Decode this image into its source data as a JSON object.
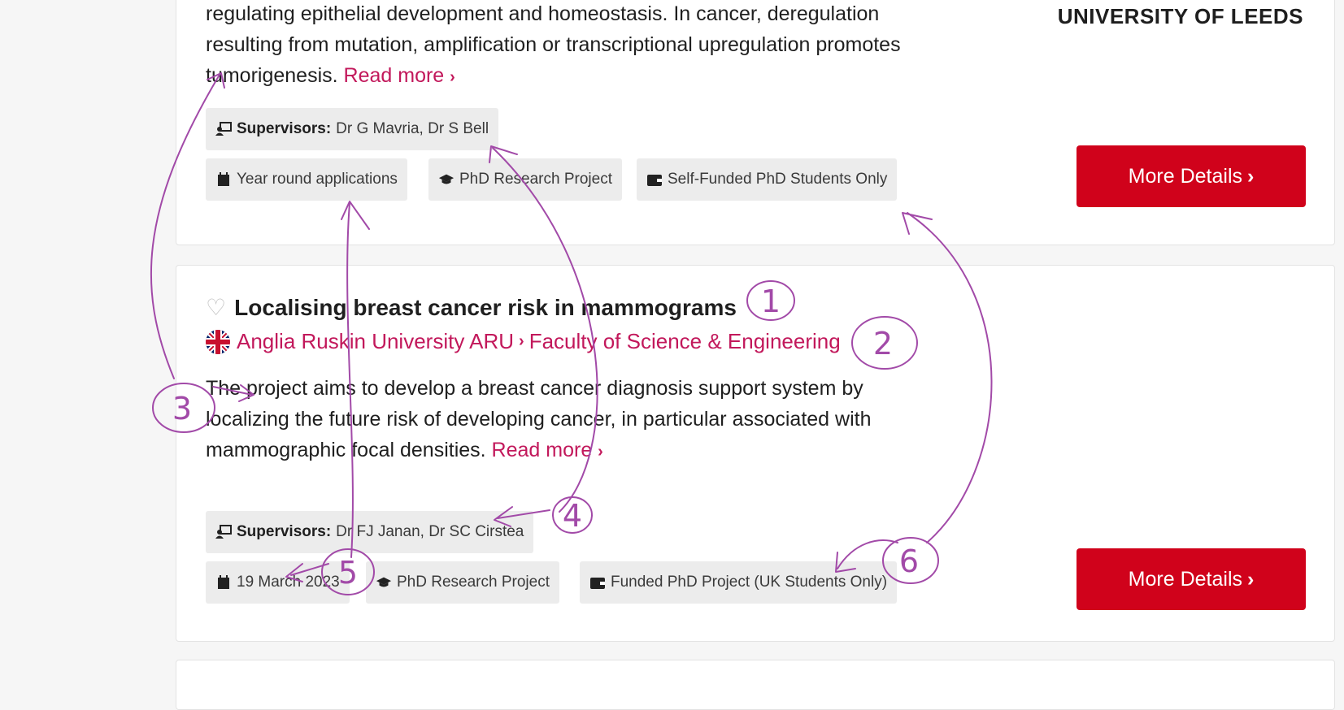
{
  "card1": {
    "description_lines": [
      "regulating epithelial development and homeostasis. In cancer, deregulation",
      "resulting from mutation, amplification or transcriptional upregulation promotes",
      "tumorigenesis."
    ],
    "read_more": "Read more",
    "logo_text": "UNIVERSITY OF LEEDS",
    "supervisors_label": "Supervisors:",
    "supervisors": "Dr G Mavria, Dr S Bell",
    "deadline": "Year round applications",
    "project_type": "PhD Research Project",
    "funding": "Self-Funded PhD Students Only",
    "more_details": "More Details"
  },
  "card2": {
    "title": "Localising breast cancer risk in mammograms",
    "institution": "Anglia Ruskin University ARU",
    "department": "Faculty of Science & Engineering",
    "description_lines": [
      "The project aims to develop a breast cancer diagnosis support system by",
      "localizing the future risk of developing cancer, in particular associated with",
      "mammographic focal densities."
    ],
    "read_more": "Read more",
    "supervisors_label": "Supervisors:",
    "supervisors": "Dr FJ Janan, Dr SC Cirstea",
    "deadline": "19 March 2023",
    "project_type": "PhD Research Project",
    "funding": "Funded PhD Project (UK Students Only)",
    "more_details": "More Details"
  },
  "annotations": {
    "numbers": [
      "1",
      "2",
      "3",
      "4",
      "5",
      "6"
    ],
    "color": "#a24aa8"
  },
  "icons": {
    "supervisor": "supervisor-icon",
    "calendar": "calendar-icon",
    "graduation": "graduation-cap-icon",
    "wallet": "wallet-icon",
    "heart": "heart-icon",
    "flag": "uk-flag-icon",
    "chevron": "chevron-right-icon"
  },
  "colors": {
    "accent_link": "#c2185b",
    "button_red": "#d0021b",
    "pill_bg": "#ececec"
  }
}
